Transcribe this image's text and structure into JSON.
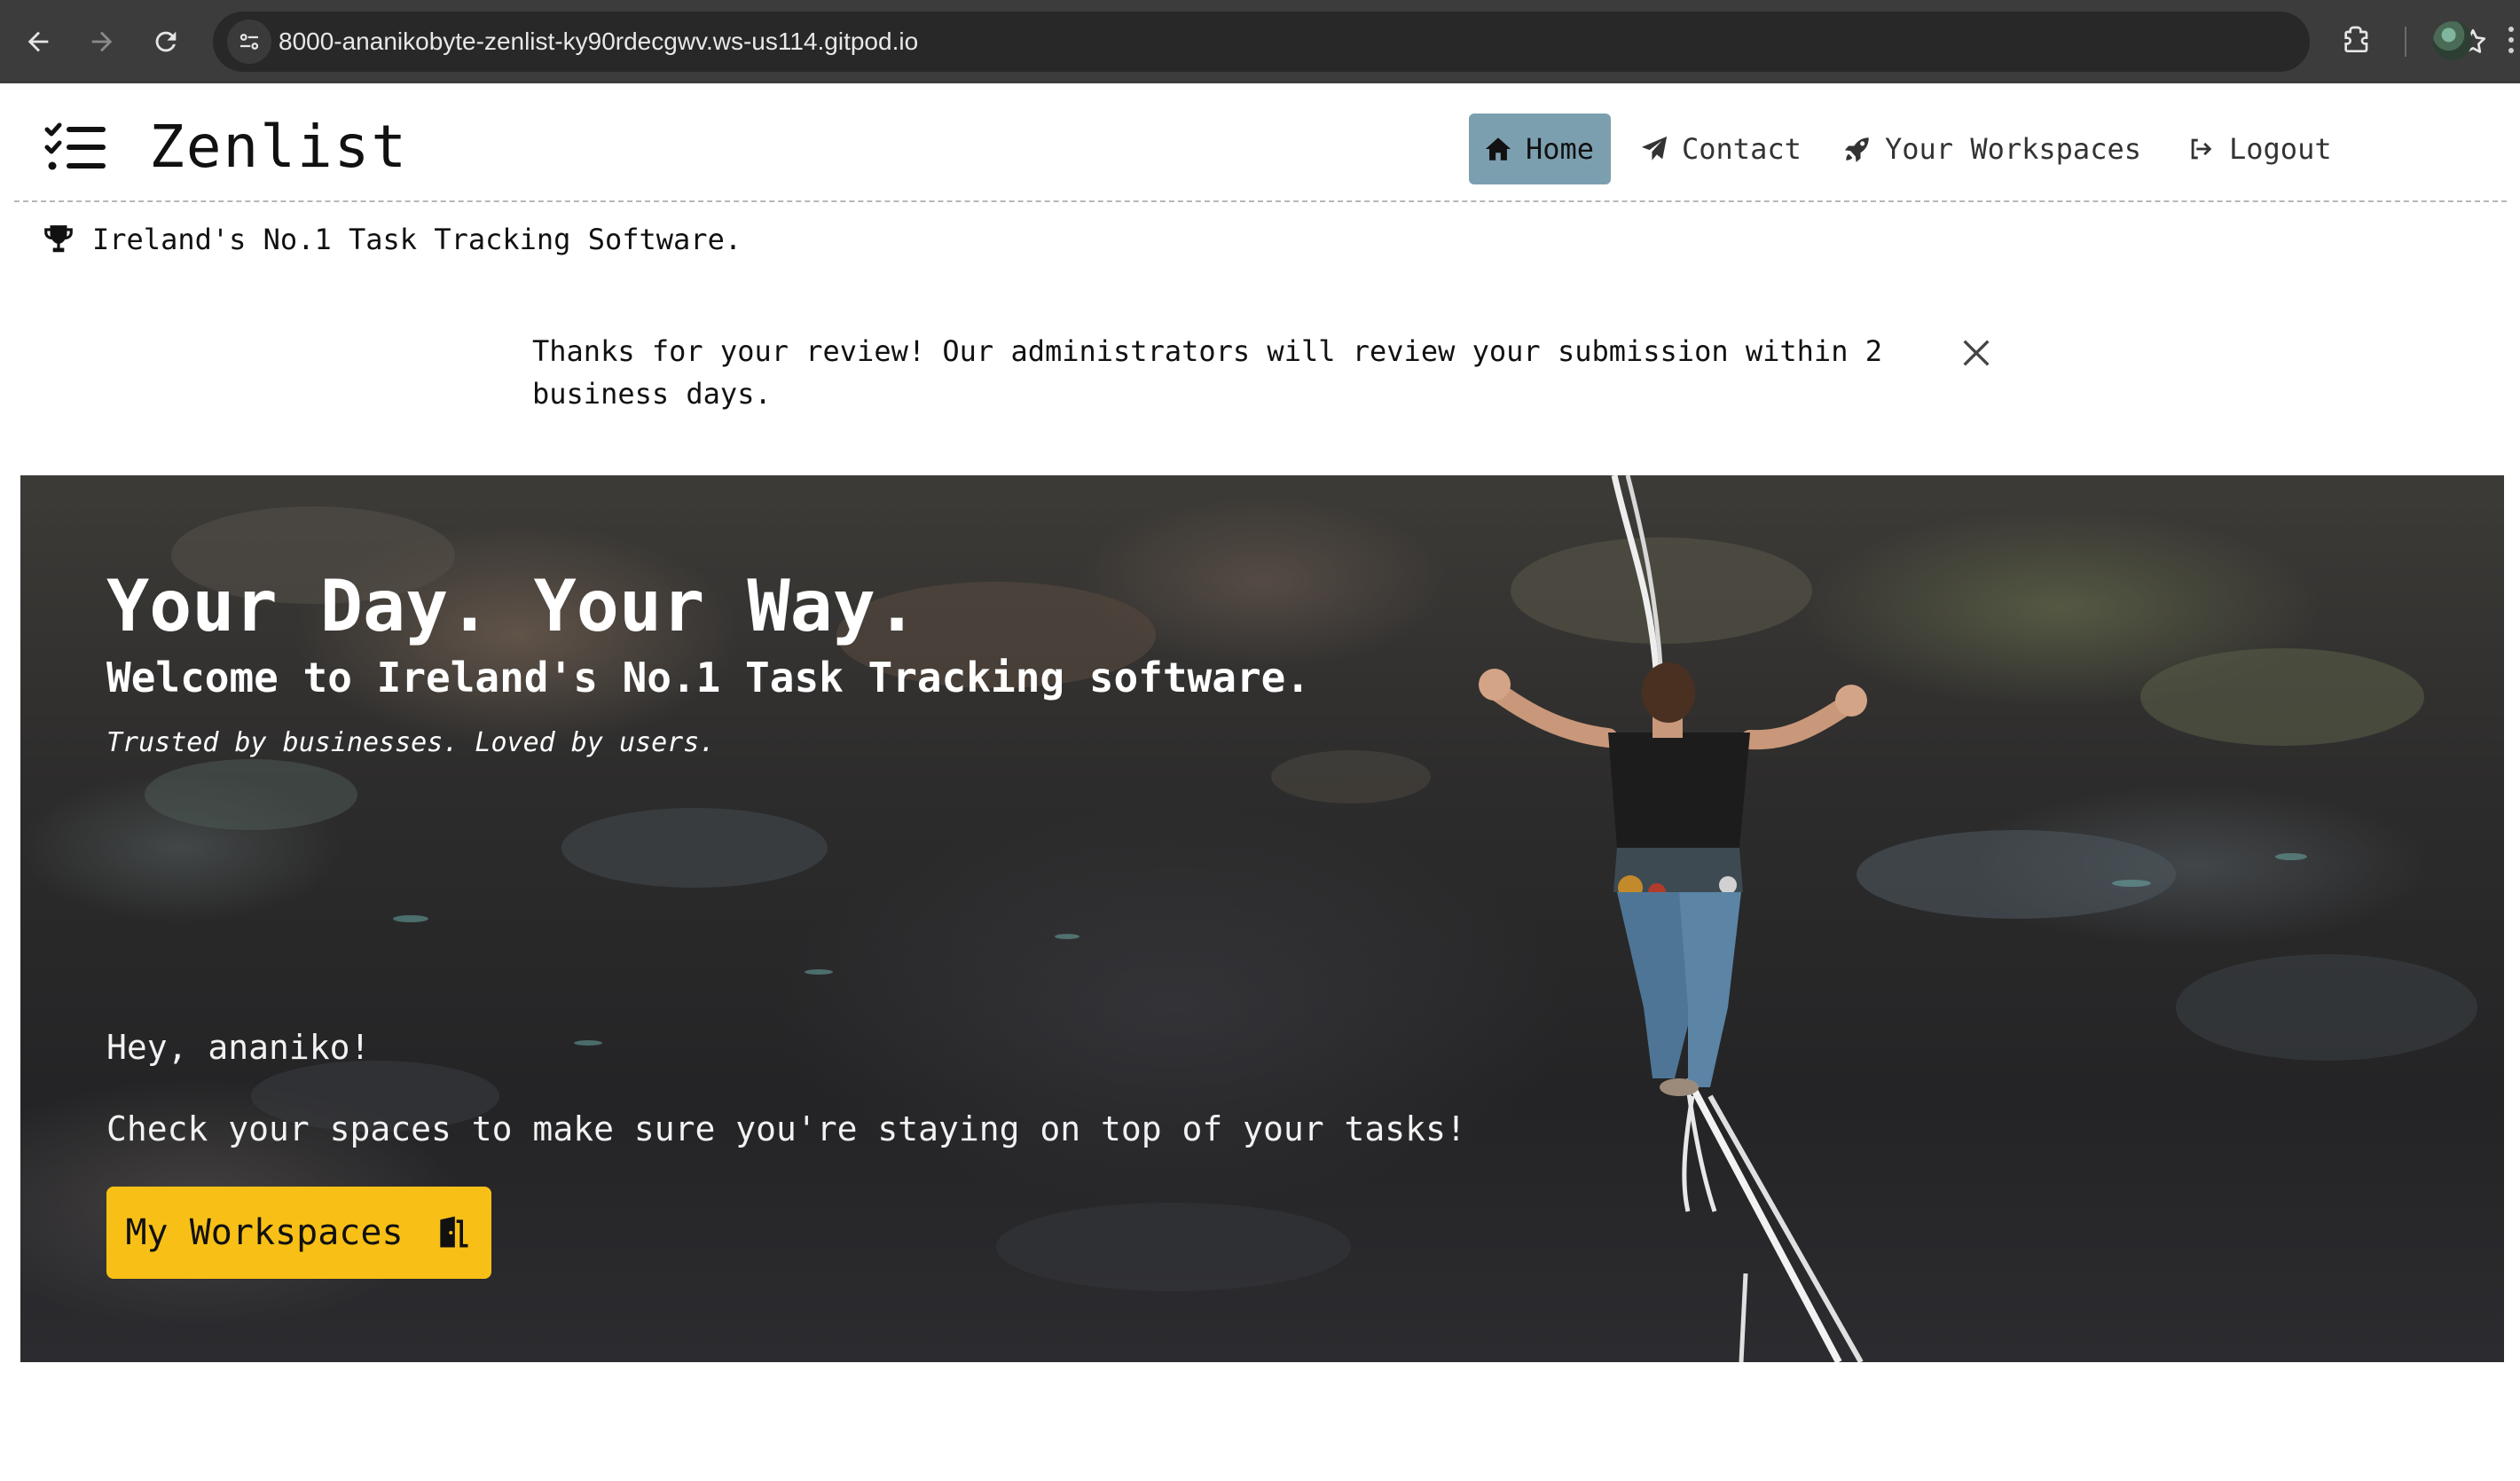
{
  "browser": {
    "url": "8000-ananikobyte-zenlist-ky90rdecgwv.ws-us114.gitpod.io",
    "icons": [
      "back-icon",
      "forward-icon",
      "reload-icon",
      "site-info-icon",
      "bookmark-star-icon",
      "extensions-icon",
      "profile-avatar",
      "menu-icon"
    ]
  },
  "header": {
    "brand": "Zenlist",
    "nav": [
      {
        "label": "Home",
        "icon": "house-icon",
        "active": true
      },
      {
        "label": "Contact",
        "icon": "paper-plane-icon",
        "active": false
      },
      {
        "label": "Your Workspaces",
        "icon": "rocket-icon",
        "active": false
      },
      {
        "label": "Logout",
        "icon": "sign-out-icon",
        "active": false
      }
    ]
  },
  "tagline": "Ireland's No.1 Task Tracking Software.",
  "alert": {
    "message": "Thanks for your review! Our administrators will review your submission within 2 business days."
  },
  "hero": {
    "title": "Your Day. Your Way.",
    "subtitle": "Welcome to Ireland's No.1 Task Tracking software.",
    "trusted": "Trusted by businesses. Loved by users.",
    "greeting": "Hey, ananiko!",
    "prompt": "Check your spaces to make sure you're staying on top of your tasks!",
    "button_label": "My Workspaces"
  },
  "colors": {
    "chrome_bg": "#3c3c3c",
    "active_nav_bg": "#7c9fb0",
    "cta_bg": "#f8c016"
  }
}
